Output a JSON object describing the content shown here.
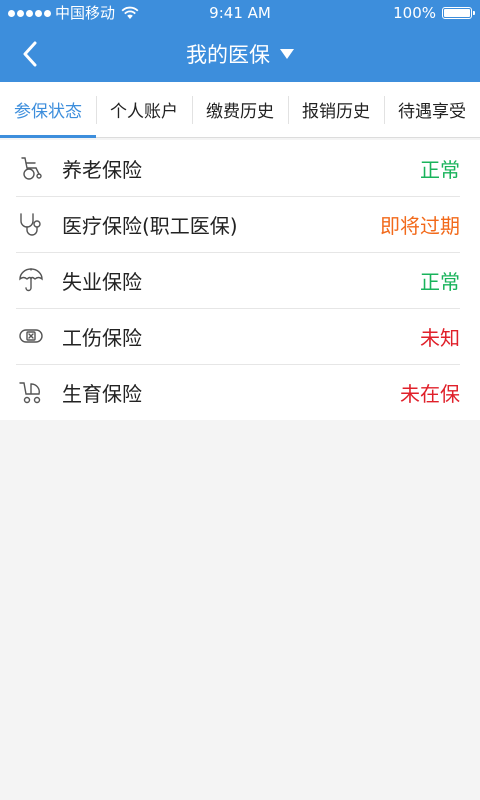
{
  "status_bar": {
    "carrier": "中国移动",
    "time": "9:41 AM",
    "battery": "100%"
  },
  "nav": {
    "title": "我的医保"
  },
  "tabs": [
    {
      "label": "参保状态",
      "active": true
    },
    {
      "label": "个人账户",
      "active": false
    },
    {
      "label": "缴费历史",
      "active": false
    },
    {
      "label": "报销历史",
      "active": false
    },
    {
      "label": "待遇享受",
      "active": false
    }
  ],
  "insurance": [
    {
      "label": "养老保险",
      "status": "正常",
      "color": "#19b35b",
      "icon": "wheelchair-icon"
    },
    {
      "label": "医疗保险(职工医保)",
      "status": "即将过期",
      "color": "#f26a1b",
      "icon": "stethoscope-icon"
    },
    {
      "label": "失业保险",
      "status": "正常",
      "color": "#19b35b",
      "icon": "umbrella-icon"
    },
    {
      "label": "工伤保险",
      "status": "未知",
      "color": "#e0202a",
      "icon": "bandage-icon"
    },
    {
      "label": "生育保险",
      "status": "未在保",
      "color": "#e0202a",
      "icon": "baby-stroller-icon"
    }
  ],
  "colors": {
    "primary": "#3d8edc",
    "normal": "#19b35b",
    "warning": "#f26a1b",
    "alert": "#e0202a"
  }
}
